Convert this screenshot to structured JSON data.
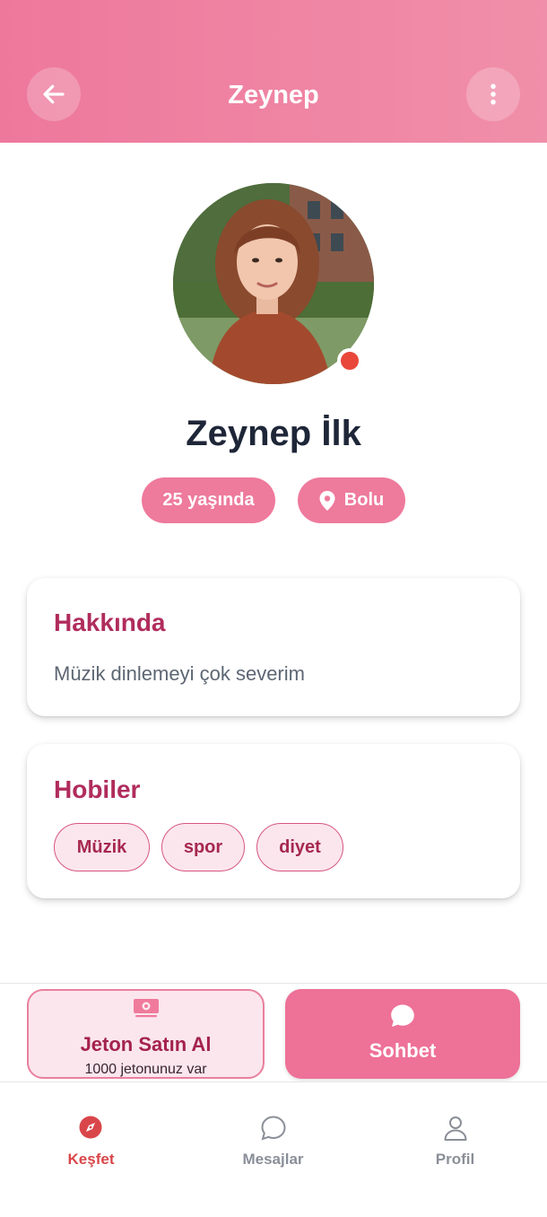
{
  "header": {
    "title": "Zeynep",
    "back_icon": "arrow-left-icon",
    "menu_icon": "more-vertical-icon"
  },
  "profile": {
    "avatar_icon": "profile-photo",
    "online": true,
    "full_name": "Zeynep İlk",
    "age_label": "25 yaşında",
    "location_label": "Bolu",
    "location_icon": "map-pin-icon"
  },
  "about": {
    "title": "Hakkında",
    "text": "Müzik dinlemeyi çok severim"
  },
  "hobbies": {
    "title": "Hobiler",
    "items": [
      "Müzik",
      "spor",
      "diyet"
    ]
  },
  "actions": {
    "buy_coins": {
      "icon": "cash-icon",
      "label": "Jeton Satın Al",
      "sublabel": "1000 jetonunuz var"
    },
    "chat": {
      "icon": "chat-bubble-icon",
      "label": "Sohbet"
    }
  },
  "nav": {
    "items": [
      {
        "label": "Keşfet",
        "icon": "compass-icon",
        "active": true
      },
      {
        "label": "Mesajlar",
        "icon": "message-circle-icon",
        "active": false
      },
      {
        "label": "Profil",
        "icon": "user-icon",
        "active": false
      }
    ]
  },
  "colors": {
    "primary": "#ee7a9c",
    "accent_text": "#b02c5c",
    "online": "#e8473a",
    "nav_active": "#d9464a"
  }
}
